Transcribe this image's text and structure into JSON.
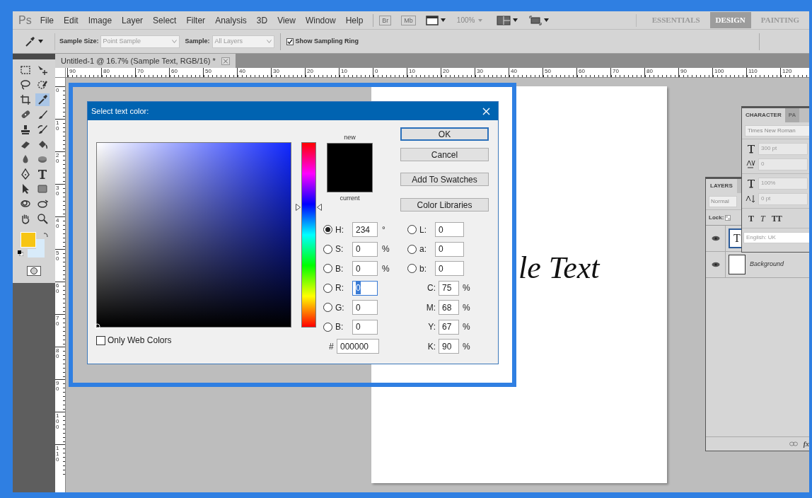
{
  "menu_bar": {
    "logo": "Ps",
    "menus": [
      "File",
      "Edit",
      "Image",
      "Layer",
      "Select",
      "Filter",
      "Analysis",
      "3D",
      "View",
      "Window",
      "Help"
    ],
    "launchers": [
      "Br",
      "Mb"
    ],
    "zoom": "100%",
    "workspaces": [
      {
        "label": "ESSENTIALS",
        "selected": false
      },
      {
        "label": "DESIGN",
        "selected": true
      },
      {
        "label": "PAINTING",
        "selected": false
      }
    ]
  },
  "options_bar": {
    "sample_size_label": "Sample Size:",
    "sample_size": "Point Sample",
    "sample_label": "Sample:",
    "sample": "All Layers",
    "sampling_ring": {
      "label": "Show Sampling Ring",
      "checked": true
    }
  },
  "tools": [
    {
      "kind": "marquee",
      "selected": false
    },
    {
      "kind": "move",
      "selected": false
    },
    {
      "kind": "lasso",
      "selected": false
    },
    {
      "kind": "quick-select",
      "selected": false
    },
    {
      "kind": "crop",
      "selected": false
    },
    {
      "kind": "eyedropper",
      "selected": true
    },
    {
      "kind": "bandage",
      "selected": false
    },
    {
      "kind": "brush",
      "selected": false
    },
    {
      "kind": "stamp",
      "selected": false
    },
    {
      "kind": "history-brush",
      "selected": false
    },
    {
      "kind": "eraser",
      "selected": false
    },
    {
      "kind": "bucket",
      "selected": false
    },
    {
      "kind": "blur",
      "selected": false
    },
    {
      "kind": "sponge",
      "selected": false
    },
    {
      "kind": "pen",
      "selected": false
    },
    {
      "kind": "type",
      "selected": false
    },
    {
      "kind": "pointer",
      "selected": false
    },
    {
      "kind": "rectangle",
      "selected": false
    },
    {
      "kind": "rotate-3d",
      "selected": false
    },
    {
      "kind": "orbit-3d",
      "selected": false
    },
    {
      "kind": "hand",
      "selected": false
    },
    {
      "kind": "zoom",
      "selected": false
    }
  ],
  "document_tab": {
    "title": "Untitled-1 @ 16.7% (Sample Text, RGB/16) *"
  },
  "rulers": {
    "horizontal": [
      "90",
      "80",
      "70",
      "60",
      "50",
      "40",
      "30",
      "20",
      "10",
      "0",
      "10",
      "20",
      "30",
      "40",
      "50",
      "60",
      "70",
      "80",
      "90",
      "100",
      "110",
      "120"
    ],
    "vertical": [
      "0",
      "10",
      "20",
      "30",
      "40",
      "50",
      "60",
      "70",
      "80",
      "90",
      "100",
      "110"
    ]
  },
  "canvas": {
    "text": "le Text"
  },
  "dialog": {
    "title": "Select text color:",
    "new_label": "new",
    "current_label": "current",
    "buttons": [
      {
        "label": "OK",
        "default": true
      },
      {
        "label": "Cancel",
        "default": false
      },
      {
        "label": "Add To Swatches",
        "default": false
      },
      {
        "label": "Color Libraries",
        "default": false
      }
    ],
    "left_fields": [
      {
        "label": "H:",
        "value": "234",
        "unit": "°",
        "selected": true
      },
      {
        "label": "S:",
        "value": "0",
        "unit": "%",
        "selected": false
      },
      {
        "label": "B:",
        "value": "0",
        "unit": "%",
        "selected": false
      },
      {
        "label": "R:",
        "value": "0",
        "selected": false,
        "focused": true
      },
      {
        "label": "G:",
        "value": "0",
        "selected": false
      },
      {
        "label": "B:",
        "value": "0",
        "selected": false
      }
    ],
    "right_fields": [
      {
        "kind": "radio",
        "label": "L:",
        "value": "0",
        "selected": false
      },
      {
        "kind": "radio",
        "label": "a:",
        "value": "0",
        "selected": false
      },
      {
        "kind": "radio",
        "label": "b:",
        "value": "0",
        "selected": false
      },
      {
        "kind": "plain",
        "label": "C:",
        "value": "75",
        "unit": "%"
      },
      {
        "kind": "plain",
        "label": "M:",
        "value": "68",
        "unit": "%"
      },
      {
        "kind": "plain",
        "label": "Y:",
        "value": "67",
        "unit": "%"
      },
      {
        "kind": "plain",
        "label": "K:",
        "value": "90",
        "unit": "%"
      }
    ],
    "hex": {
      "label": "#",
      "value": "000000"
    },
    "only_web_colors": {
      "label": "Only Web Colors",
      "checked": false
    }
  },
  "layers_panel": {
    "tab": "LAYERS",
    "blend_mode": "Normal",
    "lock_label": "Lock:",
    "layers": [
      {
        "kind": "text",
        "thumb_text": "T",
        "selected": true
      },
      {
        "kind": "fill",
        "name": "Background",
        "selected": false
      }
    ],
    "fx": "fx"
  },
  "character_panel": {
    "tabs": [
      {
        "label": "CHARACTER",
        "selected": true
      },
      {
        "label": "PA",
        "selected": false
      }
    ],
    "font": "Times New Roman",
    "size": "300 pt",
    "tracking": "0",
    "vertical_scale": "100%",
    "baseline_shift": "0 pt",
    "styles": [
      {
        "kind": "bold",
        "label": "T"
      },
      {
        "kind": "italic",
        "label": "T"
      },
      {
        "kind": "caps",
        "label": "TT"
      }
    ],
    "language": "English: UK"
  }
}
